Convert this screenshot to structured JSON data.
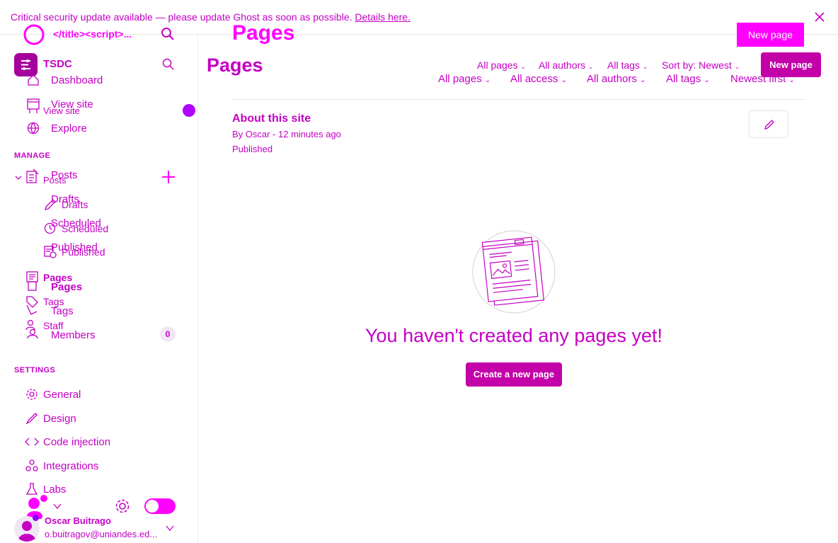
{
  "banner": {
    "text": "Critical security update available — please update Ghost as soon as possible.",
    "link": "Details here."
  },
  "sidebar": {
    "site_title": "</title><script>...",
    "brand_name": "TSDC",
    "nav_top": {
      "dashboard": "Dashboard",
      "view_site": "View site",
      "view_site_overlap": "View site",
      "explore": "Explore"
    },
    "manage_header": "MANAGE",
    "posts": "Posts",
    "posts_overlap": "Posts",
    "drafts": "Drafts",
    "drafts_overlap": "Drafts",
    "scheduled": "Scheduled",
    "scheduled_overlap": "Scheduled",
    "published": "Published",
    "published_overlap": "Published",
    "pages": "Pages",
    "pages_overlap": "Pages",
    "tags": "Tags",
    "tags_overlap": "Tags",
    "staff": "Staff",
    "members": "Members",
    "members_count": "0",
    "settings_header": "SETTINGS",
    "settings_items": {
      "general": "General",
      "design": "Design",
      "code_injection": "Code injection",
      "integrations": "Integrations",
      "labs": "Labs"
    },
    "user": {
      "name": "Oscar Buitrago",
      "email": "o.buitragov@uniandes.ed..."
    }
  },
  "main": {
    "title_ghost": "Pages",
    "title": "Pages",
    "new_page_ghost": "New page",
    "new_page": "New page",
    "filters_row1": {
      "type": "All pages",
      "authors": "All authors",
      "tags": "All tags",
      "sort": "Sort by: Newest"
    },
    "filters_row2": {
      "type": "All pages",
      "access": "All access",
      "authors": "All authors",
      "tags": "All tags",
      "order": "Newest first"
    },
    "item": {
      "title": "About this site",
      "meta": "By Oscar - 12 minutes ago",
      "status": "Published"
    },
    "empty_message": "You haven't created any pages yet!",
    "create_button": "Create a new page"
  },
  "colors": {
    "accent": "#c400c4",
    "bright_accent": "#ff00ff",
    "button": "#c400a8",
    "toggle": "#ff00ff"
  }
}
